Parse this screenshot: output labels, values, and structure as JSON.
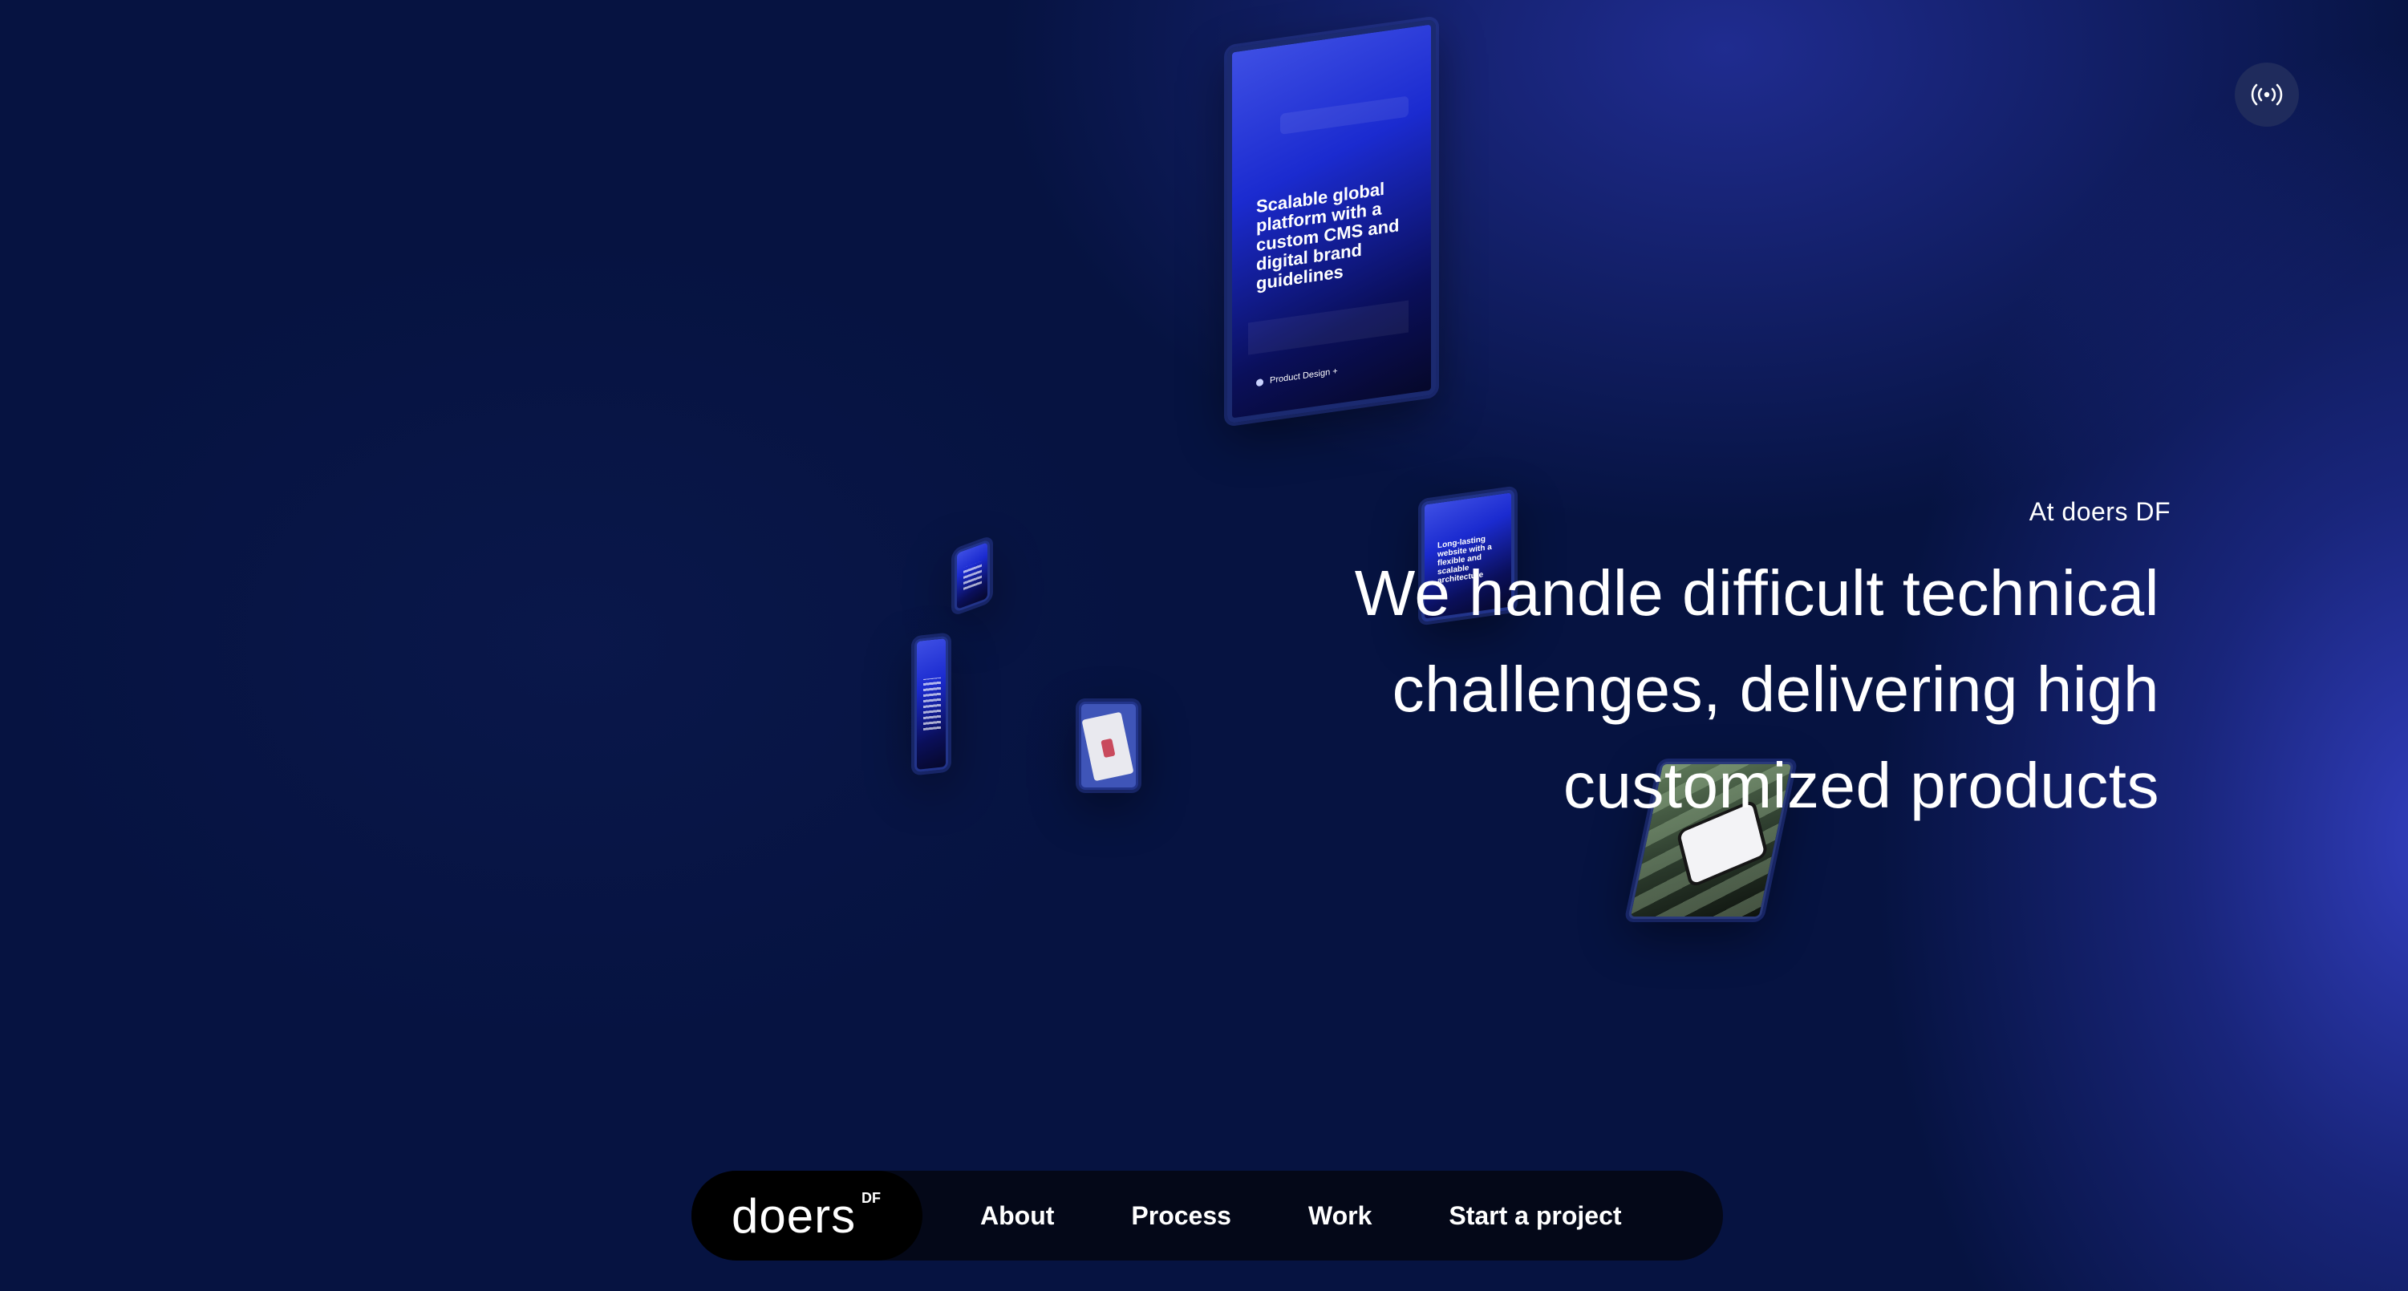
{
  "hero": {
    "eyebrow": "At doers DF",
    "headline_line1": "We handle difficult technical",
    "headline_line2": "challenges, delivering high",
    "headline_line3": "customized products"
  },
  "cards": {
    "main_headline": "Scalable global platform with a custom CMS and digital brand guidelines",
    "main_tag": "Product Design +",
    "small_headline": "Long-lasting website with a flexible and scalable architecture"
  },
  "sound_button": {
    "icon": "broadcast-icon"
  },
  "nav": {
    "logo_word": "doers",
    "logo_sup": "DF",
    "links": [
      {
        "label": "About"
      },
      {
        "label": "Process"
      },
      {
        "label": "Work"
      },
      {
        "label": "Start a project"
      }
    ]
  },
  "colors": {
    "background": "#061341",
    "accent_glow": "#3440c4",
    "nav_background": "#040818",
    "logo_pill": "#000000",
    "text": "#ffffff"
  }
}
